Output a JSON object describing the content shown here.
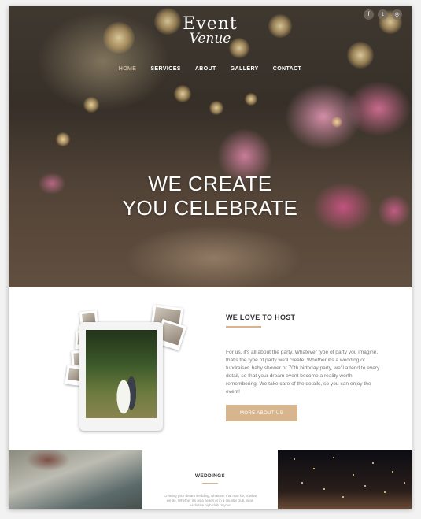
{
  "social": [
    {
      "name": "facebook",
      "glyph": "f"
    },
    {
      "name": "twitter",
      "glyph": "t"
    },
    {
      "name": "instagram",
      "glyph": "◎"
    }
  ],
  "logo": {
    "line1": "Event",
    "line2": "Venue"
  },
  "nav": {
    "items": [
      {
        "label": "HOME",
        "active": true
      },
      {
        "label": "SERVICES",
        "active": false
      },
      {
        "label": "ABOUT",
        "active": false
      },
      {
        "label": "GALLERY",
        "active": false
      },
      {
        "label": "CONTACT",
        "active": false
      }
    ]
  },
  "hero": {
    "line1": "WE CREATE",
    "line2": "YOU CELEBRATE"
  },
  "about": {
    "title": "WE LOVE TO HOST",
    "text": "For us, it's all about the party. Whatever type of party you imagine, that's the type of party we'll create. Whether it's a wedding or fundraiser, baby shower or 70th birthday party, we'll attend to every detail, so that your dream event become a reality worth remembering. We take care of the details, so you can enjoy the event!",
    "button": "MORE ABOUT US"
  },
  "weddings": {
    "title": "WEDDINGS",
    "text": "Creating your dream wedding, whatever that may be, is what we do. Whether it's on a beach or in a country club, in an exclusive nightclub or your"
  },
  "colors": {
    "accent": "#d6b58f",
    "nav_active": "#e7d3b7"
  }
}
